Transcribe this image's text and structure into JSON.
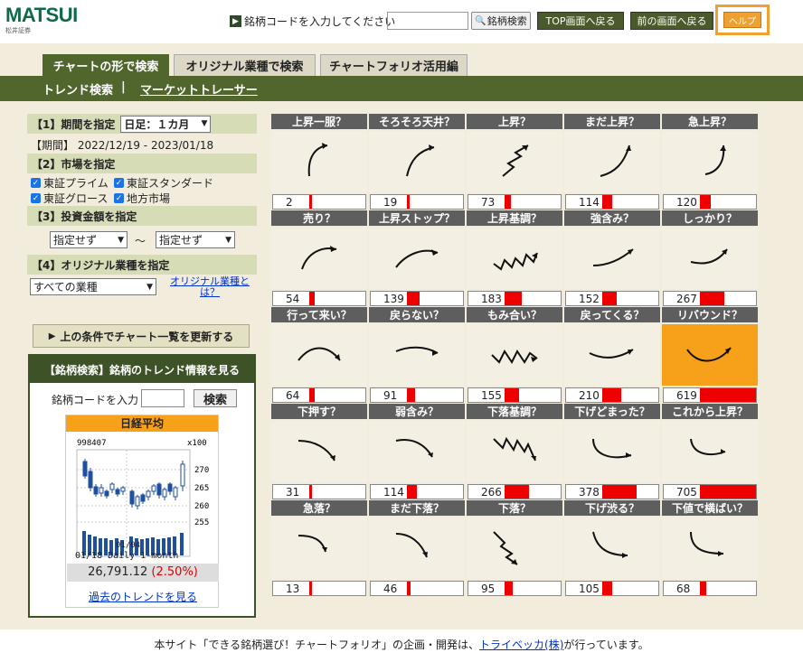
{
  "header": {
    "logo_brand": "MATSUI",
    "logo_sub": "松井証券",
    "code_prompt": "銘柄コードを入力してください",
    "search_button": "銘柄検索",
    "top_button": "TOP画面へ戻る",
    "back_button": "前の画面へ戻る",
    "help_button": "ヘルプ"
  },
  "tabs": [
    "チャートの形で検索",
    "オリジナル業種で検索",
    "チャートフォリオ活用編"
  ],
  "subnav": {
    "trend": "トレンド検索",
    "separator": "|",
    "market": "マーケットトレーサー"
  },
  "left": {
    "period_label": "【1】期間を指定",
    "period_select": "日足：１カ月",
    "period_range": "【期間】 2022/12/19 - 2023/01/18",
    "market_label": "【2】市場を指定",
    "markets": [
      "東証プライム",
      "東証スタンダード",
      "東証グロース",
      "地方市場"
    ],
    "amount_label": "【3】投資金額を指定",
    "amount_from": "指定せず",
    "amount_tilde": "～",
    "amount_to": "指定せず",
    "industry_label": "【4】オリジナル業種を指定",
    "industry_select": "すべての業種",
    "industry_link": "オリジナル業種とは？",
    "update_button": "上の条件でチャート一覧を更新する"
  },
  "lookup": {
    "header": "【銘柄検索】銘柄のトレンド情報を見る",
    "code_label": "銘柄コードを入力",
    "search_button": "検索",
    "index_title": "日経平均",
    "chart_code": "998407",
    "chart_scale": "x100",
    "y_ticks": [
      "270",
      "265",
      "260",
      "255"
    ],
    "x_tick": "01/04",
    "chart_caption": "01/18 Daily 1-month",
    "price": "26,791.12",
    "change": "(2.50%)",
    "history_link": "過去のトレンドを見る"
  },
  "trend_cells": [
    {
      "title": "上昇一服？",
      "count": "2",
      "fill": 0.003
    },
    {
      "title": "そろそろ天井？",
      "count": "19",
      "fill": 0.03
    },
    {
      "title": "上昇？",
      "count": "73",
      "fill": 0.12
    },
    {
      "title": "まだ上昇？",
      "count": "114",
      "fill": 0.18
    },
    {
      "title": "急上昇？",
      "count": "120",
      "fill": 0.19
    },
    {
      "title": "売り？",
      "count": "54",
      "fill": 0.09
    },
    {
      "title": "上昇ストップ？",
      "count": "139",
      "fill": 0.22
    },
    {
      "title": "上昇基調？",
      "count": "183",
      "fill": 0.3
    },
    {
      "title": "強含み？",
      "count": "152",
      "fill": 0.25
    },
    {
      "title": "しっかり？",
      "count": "267",
      "fill": 0.43
    },
    {
      "title": "行って来い？",
      "count": "64",
      "fill": 0.1
    },
    {
      "title": "戻らない？",
      "count": "91",
      "fill": 0.15
    },
    {
      "title": "もみ合い？",
      "count": "155",
      "fill": 0.25
    },
    {
      "title": "戻ってくる？",
      "count": "210",
      "fill": 0.34
    },
    {
      "title": "リバウンド？",
      "count": "619",
      "fill": 1.0
    },
    {
      "title": "下押す？",
      "count": "31",
      "fill": 0.05
    },
    {
      "title": "弱含み？",
      "count": "114",
      "fill": 0.18
    },
    {
      "title": "下落基調？",
      "count": "266",
      "fill": 0.43
    },
    {
      "title": "下げどまった？",
      "count": "378",
      "fill": 0.61
    },
    {
      "title": "これから上昇？",
      "count": "705",
      "fill": 1.0
    },
    {
      "title": "急落？",
      "count": "13",
      "fill": 0.02
    },
    {
      "title": "まだ下落？",
      "count": "46",
      "fill": 0.07
    },
    {
      "title": "下落？",
      "count": "95",
      "fill": 0.15
    },
    {
      "title": "下げ渋る？",
      "count": "105",
      "fill": 0.17
    },
    {
      "title": "下値で横ばい？",
      "count": "68",
      "fill": 0.11
    }
  ],
  "footer": {
    "pre": "本サイト「できる銘柄選び！チャートフォリオ」の企画・開発は、",
    "link": "トライベッカ(株)",
    "post": "が行っています。"
  },
  "colors": {
    "accent": "#51662d",
    "highlight": "#f7a11a",
    "help": "#f0a030",
    "bar": "#e00000"
  }
}
